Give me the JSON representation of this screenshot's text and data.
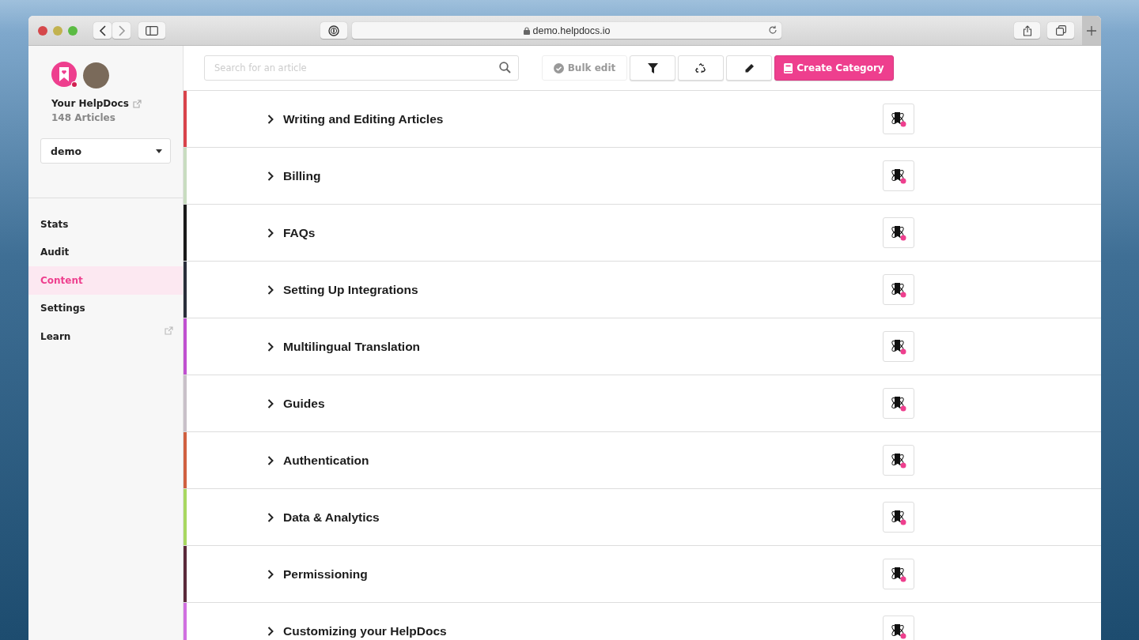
{
  "browser": {
    "address": "demo.helpdocs.io"
  },
  "sidebar": {
    "site_name": "Your HelpDocs",
    "article_count": "148 Articles",
    "project_select": "demo",
    "items": [
      {
        "label": "Stats",
        "selected": false,
        "external": false
      },
      {
        "label": "Audit",
        "selected": false,
        "external": false
      },
      {
        "label": "Content",
        "selected": true,
        "external": false
      },
      {
        "label": "Settings",
        "selected": false,
        "external": false
      },
      {
        "label": "Learn",
        "selected": false,
        "external": true
      }
    ]
  },
  "toolbar": {
    "search": {
      "placeholder": "Search for an article"
    },
    "bulk_edit": "Bulk edit",
    "create": "Create Category"
  },
  "categories": [
    {
      "title": "Writing and Editing Articles",
      "color": "#d9434b"
    },
    {
      "title": "Billing",
      "color": "#c8dcc0"
    },
    {
      "title": "FAQs",
      "color": "#1a1a1a"
    },
    {
      "title": "Setting Up Integrations",
      "color": "#2a2e3a"
    },
    {
      "title": "Multilingual Translation",
      "color": "#c050d0"
    },
    {
      "title": "Guides",
      "color": "#c8c0c8"
    },
    {
      "title": "Authentication",
      "color": "#d06040"
    },
    {
      "title": "Data & Analytics",
      "color": "#a8d860"
    },
    {
      "title": "Permissioning",
      "color": "#5a2a3a"
    },
    {
      "title": "Customizing your HelpDocs",
      "color": "#d070e0"
    }
  ]
}
